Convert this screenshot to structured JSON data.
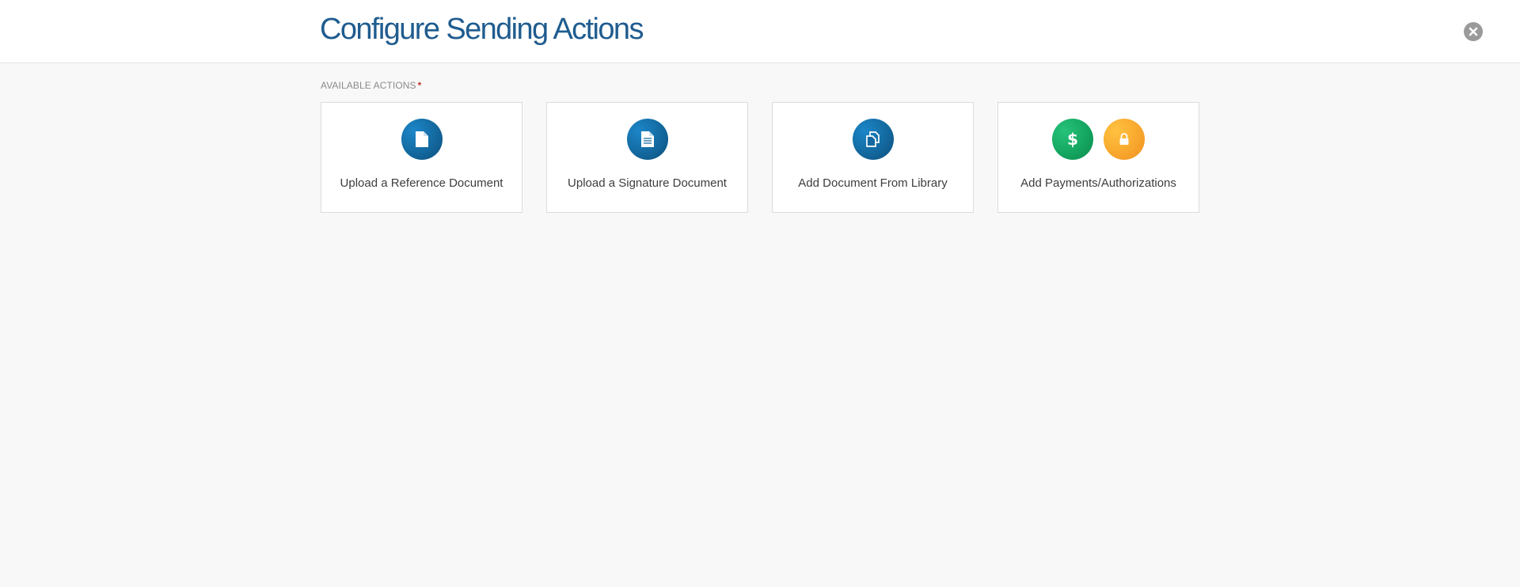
{
  "header": {
    "title": "Configure Sending Actions",
    "close_icon": "close-circle-icon"
  },
  "section": {
    "label": "AVAILABLE ACTIONS",
    "required_marker": "*"
  },
  "actions": [
    {
      "label": "Upload a Reference Document",
      "icons": [
        "document-icon"
      ],
      "color": "#13699f"
    },
    {
      "label": "Upload a Signature Document",
      "icons": [
        "document-lines-icon"
      ],
      "color": "#13699f"
    },
    {
      "label": "Add Document From Library",
      "icons": [
        "documents-copy-icon"
      ],
      "color": "#13699f"
    },
    {
      "label": "Add Payments/Authorizations",
      "icons": [
        "dollar-icon",
        "lock-icon"
      ],
      "colors": [
        "#14a660",
        "#f8a82e"
      ]
    }
  ],
  "colors": {
    "accent": "#1f5c8f",
    "required": "#c0392b",
    "background": "#f8f8f8"
  }
}
